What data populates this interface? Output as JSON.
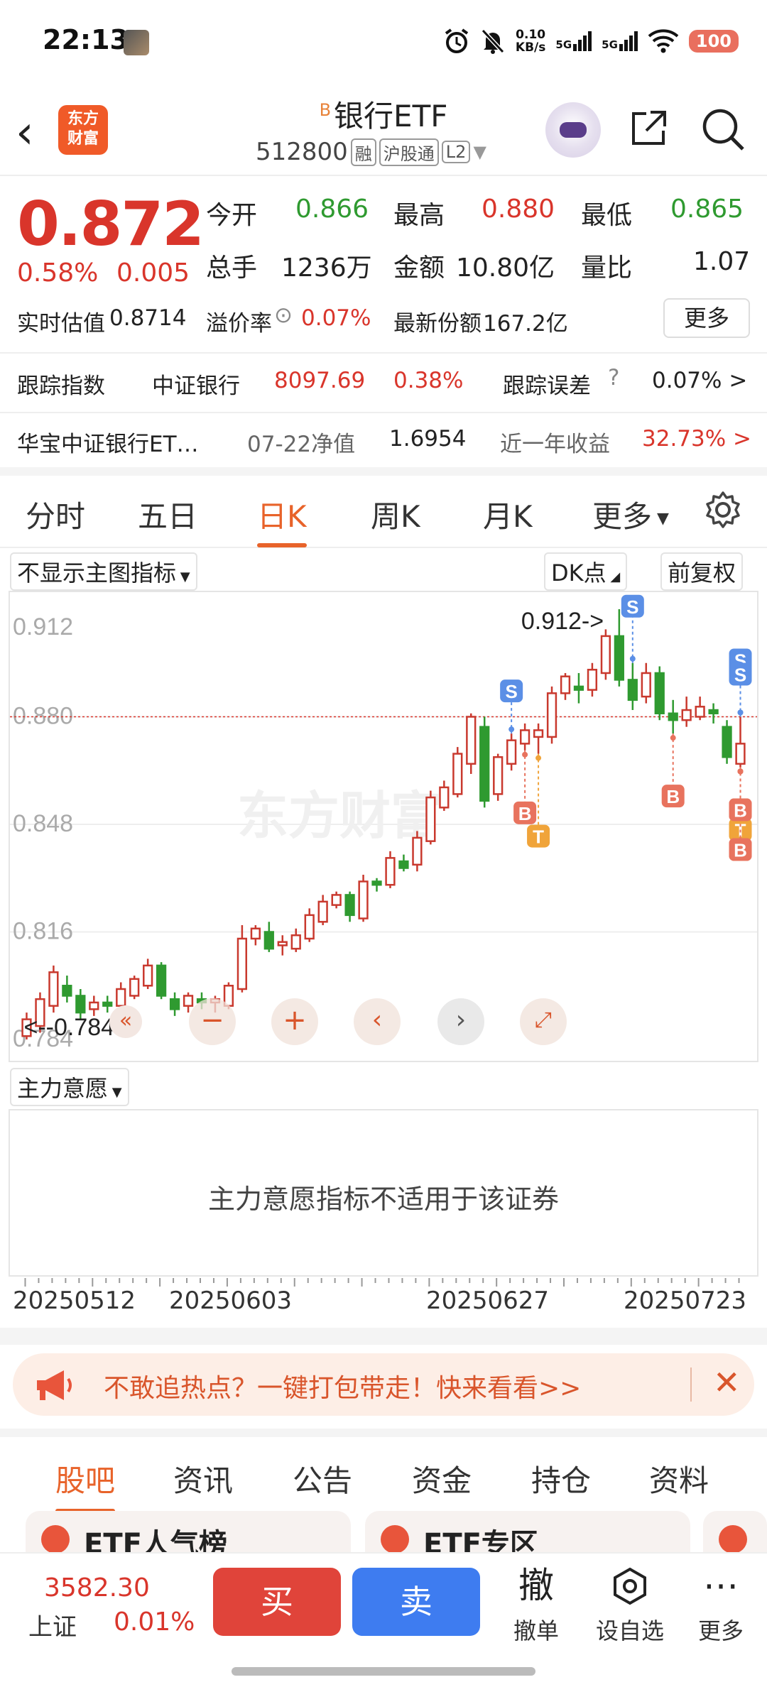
{
  "status": {
    "time": "22:13",
    "net_speed_value": "0.10",
    "net_speed_unit": "KB/s",
    "sig1": "5G",
    "sig2": "5G",
    "battery": "100"
  },
  "header": {
    "logo_line1": "东方",
    "logo_line2": "财富",
    "badge": "B",
    "title": "银行ETF",
    "code": "512800",
    "tag1": "融",
    "tag2": "沪股通",
    "tag3": "L2"
  },
  "quote": {
    "price": "0.872",
    "pct": "0.58%",
    "change": "0.005",
    "open_label": "今开",
    "open": "0.866",
    "high_label": "最高",
    "high": "0.880",
    "low_label": "最低",
    "low": "0.865",
    "vol_label": "总手",
    "vol": "1236万",
    "amt_label": "金额",
    "amt": "10.80亿",
    "ratio_label": "量比",
    "ratio": "1.07",
    "est_label": "实时估值",
    "est": "0.8714",
    "prem_label": "溢价率",
    "prem": "0.07%",
    "share_label": "最新份额",
    "share": "167.2亿",
    "more": "更多"
  },
  "tracking": {
    "label": "跟踪指数",
    "index_name": "中证银行",
    "index_value": "8097.69",
    "index_pct": "0.38%",
    "err_label": "跟踪误差",
    "err_value": "0.07% >"
  },
  "nav": {
    "fund_name": "华宝中证银行ET…",
    "date_label": "07-22净值",
    "nav_value": "1.6954",
    "ret_label": "近一年收益",
    "ret_value": "32.73% >"
  },
  "ktabs": [
    "分时",
    "五日",
    "日K",
    "周K",
    "月K",
    "更多"
  ],
  "chart_ctrl": {
    "main_indicator": "不显示主图指标",
    "dk": "DK点",
    "fq": "前复权",
    "sub_indicator": "主力意愿",
    "sub_na": "主力意愿指标不适用于该证券"
  },
  "chart_data": {
    "type": "candlestick",
    "y_ticks": [
      "0.912",
      "0.880",
      "0.848",
      "0.816",
      "0.784"
    ],
    "ylim": [
      0.784,
      0.912
    ],
    "high_label": "0.912->",
    "low_label": "<--0.784",
    "watermark": "东方财富",
    "dates": [
      "20250512",
      "20250603",
      "20250627",
      "20250723"
    ],
    "candles": [
      [
        0.785,
        0.79,
        0.784,
        0.792
      ],
      [
        0.788,
        0.796,
        0.786,
        0.798
      ],
      [
        0.794,
        0.804,
        0.792,
        0.806
      ],
      [
        0.8,
        0.797,
        0.795,
        0.803
      ],
      [
        0.797,
        0.792,
        0.79,
        0.799
      ],
      [
        0.793,
        0.795,
        0.791,
        0.797
      ],
      [
        0.795,
        0.794,
        0.792,
        0.797
      ],
      [
        0.794,
        0.799,
        0.793,
        0.801
      ],
      [
        0.797,
        0.802,
        0.796,
        0.803
      ],
      [
        0.8,
        0.806,
        0.799,
        0.808
      ],
      [
        0.806,
        0.797,
        0.796,
        0.807
      ],
      [
        0.796,
        0.793,
        0.791,
        0.798
      ],
      [
        0.794,
        0.797,
        0.792,
        0.798
      ],
      [
        0.796,
        0.795,
        0.793,
        0.798
      ],
      [
        0.795,
        0.796,
        0.792,
        0.797
      ],
      [
        0.794,
        0.8,
        0.793,
        0.801
      ],
      [
        0.799,
        0.814,
        0.798,
        0.818
      ],
      [
        0.814,
        0.817,
        0.812,
        0.818
      ],
      [
        0.816,
        0.811,
        0.81,
        0.819
      ],
      [
        0.812,
        0.813,
        0.809,
        0.815
      ],
      [
        0.811,
        0.815,
        0.81,
        0.817
      ],
      [
        0.814,
        0.821,
        0.813,
        0.823
      ],
      [
        0.819,
        0.825,
        0.818,
        0.827
      ],
      [
        0.824,
        0.827,
        0.823,
        0.828
      ],
      [
        0.827,
        0.821,
        0.819,
        0.828
      ],
      [
        0.82,
        0.831,
        0.819,
        0.833
      ],
      [
        0.831,
        0.83,
        0.828,
        0.832
      ],
      [
        0.83,
        0.838,
        0.829,
        0.84
      ],
      [
        0.837,
        0.835,
        0.834,
        0.839
      ],
      [
        0.836,
        0.844,
        0.834,
        0.846
      ],
      [
        0.843,
        0.856,
        0.842,
        0.858
      ],
      [
        0.853,
        0.859,
        0.852,
        0.861
      ],
      [
        0.857,
        0.869,
        0.856,
        0.871
      ],
      [
        0.866,
        0.88,
        0.863,
        0.881
      ],
      [
        0.877,
        0.855,
        0.853,
        0.88
      ],
      [
        0.857,
        0.868,
        0.855,
        0.869
      ],
      [
        0.866,
        0.873,
        0.864,
        0.875
      ],
      [
        0.872,
        0.876,
        0.87,
        0.878
      ],
      [
        0.874,
        0.876,
        0.869,
        0.878
      ],
      [
        0.874,
        0.887,
        0.872,
        0.889
      ],
      [
        0.887,
        0.892,
        0.885,
        0.893
      ],
      [
        0.889,
        0.888,
        0.884,
        0.893
      ],
      [
        0.888,
        0.894,
        0.886,
        0.896
      ],
      [
        0.893,
        0.904,
        0.891,
        0.906
      ],
      [
        0.904,
        0.891,
        0.889,
        0.912
      ],
      [
        0.891,
        0.885,
        0.882,
        0.896
      ],
      [
        0.886,
        0.893,
        0.884,
        0.896
      ],
      [
        0.893,
        0.881,
        0.879,
        0.895
      ],
      [
        0.881,
        0.879,
        0.875,
        0.885
      ],
      [
        0.879,
        0.882,
        0.877,
        0.886
      ],
      [
        0.88,
        0.883,
        0.879,
        0.886
      ],
      [
        0.882,
        0.881,
        0.878,
        0.884
      ],
      [
        0.877,
        0.868,
        0.866,
        0.879
      ],
      [
        0.866,
        0.872,
        0.865,
        0.88
      ]
    ],
    "signals": [
      {
        "i": 36,
        "label": "S"
      },
      {
        "i": 37,
        "label": "B"
      },
      {
        "i": 38,
        "label": "T"
      },
      {
        "i": 45,
        "label": "S"
      },
      {
        "i": 48,
        "label": "B"
      },
      {
        "i": 53,
        "label": "S"
      },
      {
        "i": 54,
        "label": "B"
      },
      {
        "i": 55,
        "label": "T"
      },
      {
        "i": 56,
        "label": "B"
      },
      {
        "i": 57,
        "label": "B"
      },
      {
        "i": 62,
        "label": "S"
      },
      {
        "i": 63,
        "label": "B"
      }
    ]
  },
  "banner": {
    "text": "不敢追热点？一键打包带走！快来看看>>"
  },
  "ctabs": [
    "股吧",
    "资讯",
    "公告",
    "资金",
    "持仓",
    "资料"
  ],
  "peeks": {
    "p1": "ETF人气榜",
    "p2": "ETF专区"
  },
  "bottom": {
    "idx_value": "3582.30",
    "idx_name": "上证",
    "idx_pct": "0.01%",
    "buy": "买",
    "sell": "卖",
    "cancel_icon": "撤",
    "cancel": "撤单",
    "fav": "设自选",
    "more": "更多"
  }
}
